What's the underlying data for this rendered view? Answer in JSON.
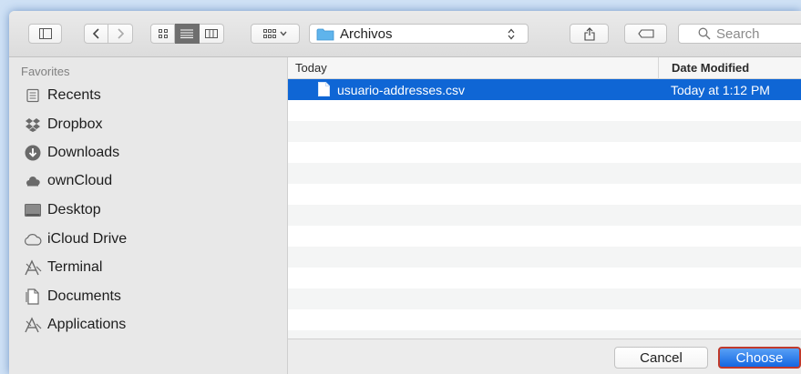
{
  "toolbar": {
    "path": "Archivos",
    "search_placeholder": "Search"
  },
  "sidebar": {
    "section_title": "Favorites",
    "items": [
      {
        "label": "Recents",
        "icon": "recents-icon"
      },
      {
        "label": "Dropbox",
        "icon": "dropbox-icon"
      },
      {
        "label": "Downloads",
        "icon": "downloads-icon"
      },
      {
        "label": "ownCloud",
        "icon": "owncloud-icon"
      },
      {
        "label": "Desktop",
        "icon": "desktop-icon"
      },
      {
        "label": "iCloud Drive",
        "icon": "icloud-icon"
      },
      {
        "label": "Terminal",
        "icon": "terminal-icon"
      },
      {
        "label": "Documents",
        "icon": "documents-icon"
      },
      {
        "label": "Applications",
        "icon": "applications-icon"
      }
    ]
  },
  "list": {
    "header_name": "Today",
    "header_date": "Date Modified",
    "files": [
      {
        "name": "usuario-addresses.csv",
        "date": "Today at 1:12 PM",
        "selected": true
      }
    ]
  },
  "buttons": {
    "cancel": "Cancel",
    "choose": "Choose"
  },
  "colors": {
    "selection": "#0f66d5",
    "accent_button": "#1467e2",
    "highlight_border": "#c0392b"
  }
}
